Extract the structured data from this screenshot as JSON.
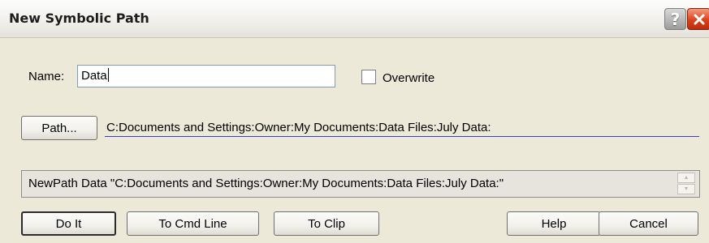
{
  "window": {
    "title": "New Symbolic Path",
    "help_icon": "question-mark-icon",
    "close_icon": "close-x-icon"
  },
  "form": {
    "name_label": "Name:",
    "name_value": "Data",
    "overwrite_label": "Overwrite",
    "overwrite_checked": false,
    "path_button": "Path...",
    "path_value": "C:Documents and Settings:Owner:My Documents:Data Files:July Data:"
  },
  "command": {
    "text": "NewPath Data \"C:Documents and Settings:Owner:My Documents:Data Files:July Data:\""
  },
  "buttons": {
    "do_it": "Do It",
    "to_cmd_line": "To Cmd Line",
    "to_clip": "To Clip",
    "help": "Help",
    "cancel": "Cancel"
  },
  "colors": {
    "dialog_bg": "#ece9d8",
    "path_underline": "#3d3dc8",
    "close_button": "#d9421d"
  }
}
